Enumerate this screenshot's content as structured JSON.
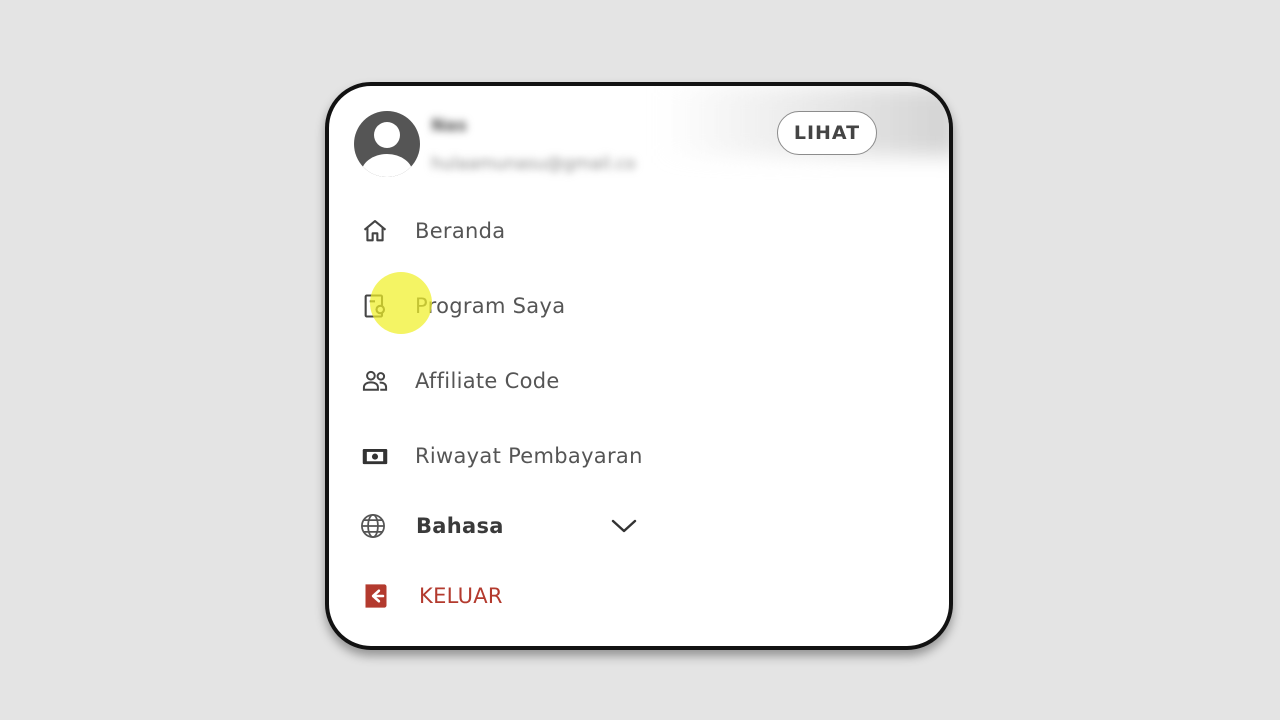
{
  "header": {
    "user_name": "Nas",
    "user_email": "hulaamunasu@gmail.co",
    "view_label": "LIHAT"
  },
  "menu": {
    "items": [
      {
        "label": "Beranda",
        "icon": "home-icon"
      },
      {
        "label": "Program Saya",
        "icon": "program-icon"
      },
      {
        "label": "Affiliate Code",
        "icon": "users-icon"
      },
      {
        "label": "Riwayat Pembayaran",
        "icon": "payment-icon"
      }
    ],
    "language": {
      "label": "Bahasa",
      "icon": "globe-icon"
    },
    "logout": {
      "label": "KELUAR",
      "icon": "logout-icon",
      "color": "#b33a2e"
    }
  },
  "colors": {
    "background": "#e4e4e4",
    "card": "#ffffff",
    "text": "#555555",
    "logout": "#b33a2e",
    "cursor_highlight": "#f0f028"
  }
}
